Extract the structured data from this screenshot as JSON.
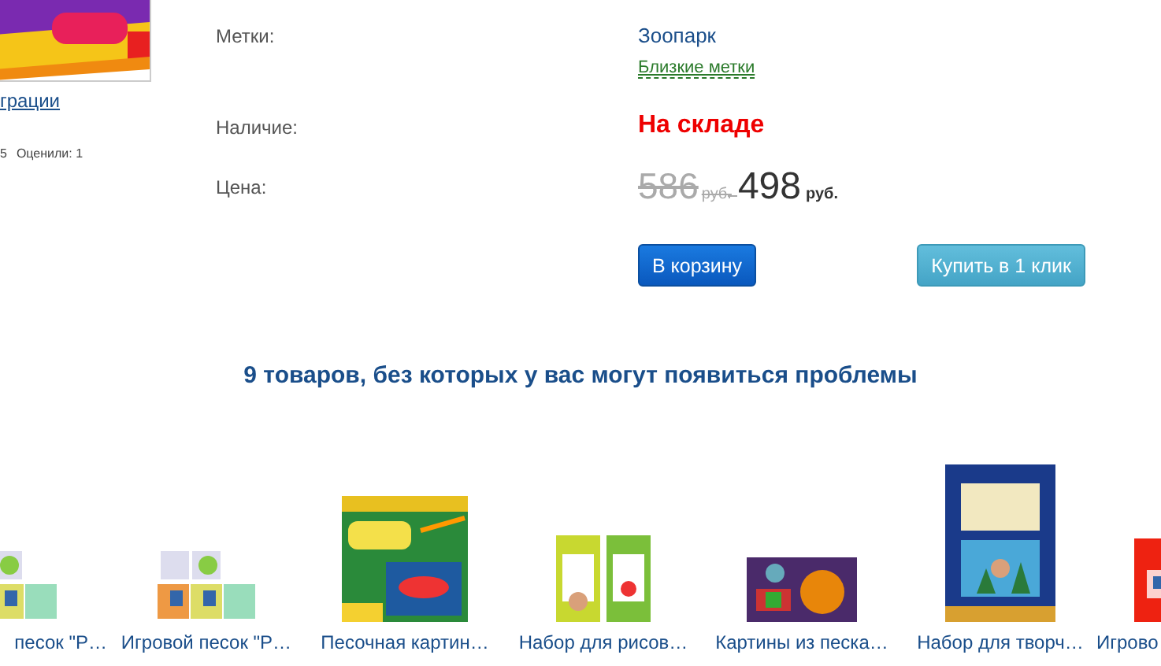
{
  "product": {
    "gallery_link": "грации",
    "rating": "5",
    "votes": "Оценили: 1"
  },
  "details": {
    "tags_label": "Метки:",
    "tag": "Зоопарк",
    "related_tags": "Близкие метки",
    "availability_label": "Наличие:",
    "availability": "На складе",
    "price_label": "Цена:",
    "old_price": "586",
    "old_currency": "руб.",
    "price": "498",
    "currency": "руб."
  },
  "buttons": [
    {
      "kind": "primary",
      "label": "В корзину"
    },
    {
      "kind": "secondary",
      "label": "Купить в 1 клик"
    }
  ],
  "related": {
    "title": "9 товаров, без которых у вас могут появиться проблемы",
    "items": [
      {
        "name": "песок \"Р…"
      },
      {
        "name": "Игровой песок \"Р…"
      },
      {
        "name": "Песочная картин…"
      },
      {
        "name": "Набор для рисов…"
      },
      {
        "name": "Картины из песка…"
      },
      {
        "name": "Набор для творч…"
      },
      {
        "name": "Игрово"
      }
    ]
  }
}
